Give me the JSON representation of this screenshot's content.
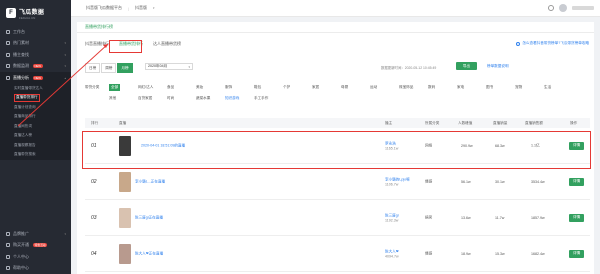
{
  "app": {
    "logo_text": "飞瓜数据",
    "logo_sub": "FEIGUA.CN",
    "logo_mark": "F"
  },
  "sidebar": {
    "items": [
      {
        "label": "工作台",
        "icon": "home-icon"
      },
      {
        "label": "热门素材",
        "icon": "fire-icon"
      },
      {
        "label": "播主查找",
        "icon": "user-search-icon"
      },
      {
        "label": "数据监测",
        "icon": "monitor-icon",
        "badge": "NEW"
      },
      {
        "label": "直播分析",
        "icon": "live-icon",
        "badge": "NEW"
      }
    ],
    "subitems": [
      {
        "label": "实时直播带货达人"
      },
      {
        "label": "直播带货排行",
        "current": true
      },
      {
        "label": "直播计划查询"
      },
      {
        "label": "直播商品排行"
      },
      {
        "label": "直播间热词"
      },
      {
        "label": "直播达人榜"
      },
      {
        "label": "直播观察报告"
      },
      {
        "label": "直播带货搜索"
      }
    ],
    "bottom_items": [
      {
        "label": "品牌推广",
        "icon": "brand-icon"
      },
      {
        "label": "购买开通",
        "icon": "cart-icon",
        "badge": "特惠活动"
      },
      {
        "label": "个人中心",
        "icon": "person-icon"
      },
      {
        "label": "帮助中心",
        "icon": "help-icon"
      }
    ]
  },
  "topbar": {
    "crumbs": [
      "抖音版飞瓜数据平台",
      "抖音版"
    ]
  },
  "page": {
    "heading": "直播带货排行榜",
    "tabs": [
      {
        "label": "抖音直播排行",
        "selected": false
      },
      {
        "label": "直播带货排行",
        "selected": true
      },
      {
        "label": "达人直播带货榜",
        "selected": false
      }
    ],
    "top_link": "怎么查看抖音带货榜单?飞瓜带货榜单攻略",
    "period_buttons": [
      {
        "label": "日榜",
        "on": false
      },
      {
        "label": "周榜",
        "on": false
      },
      {
        "label": "月榜",
        "on": true
      }
    ],
    "month_value": "2020年04月",
    "update_time": "数据更新时间：2020-05-12 10:45:49",
    "export_label": "导出",
    "explain_link": "榜单数据说明",
    "category_label": "带货分类",
    "categories": [
      {
        "label": "全部",
        "on": true
      },
      {
        "label": "网红/达人"
      },
      {
        "label": "食品"
      },
      {
        "label": "美妆"
      },
      {
        "label": "服饰"
      },
      {
        "label": "鞋包"
      },
      {
        "label": "个护"
      },
      {
        "label": "家居"
      },
      {
        "label": "母婴"
      },
      {
        "label": "运动"
      },
      {
        "label": "珠宝饰品"
      },
      {
        "label": "数码"
      },
      {
        "label": "家电"
      },
      {
        "label": "图书"
      },
      {
        "label": "宠物"
      },
      {
        "label": "生活"
      },
      {
        "label": "其他"
      },
      {
        "label": "百货家居"
      },
      {
        "label": "时尚"
      },
      {
        "label": "蔬菜水果"
      },
      {
        "label": "知识游戏",
        "blue": true
      },
      {
        "label": "手工手作"
      }
    ]
  },
  "table": {
    "headers": [
      "排行",
      "直播",
      "播主",
      "所属分类",
      "人数峰值",
      "直播销量",
      "直播销售额",
      "操作"
    ],
    "rows": [
      {
        "rank": "01",
        "title": "2020-04-01 18:51:09的直播",
        "anchor": "罗永浩",
        "fans": "1165.1w",
        "category": "网络",
        "peak": "290.9w",
        "sales": "68.3w",
        "revenue": "1.1亿",
        "action": "详情",
        "thumb_color": "#3a3a3a"
      },
      {
        "rank": "02",
        "title": "李小璐L...正在直播",
        "anchor": "李小璐的Lpjo嘛",
        "fans": "1106.7w",
        "category": "情感",
        "peak": "56.1w",
        "sales": "30.1w",
        "revenue": "3534.4w",
        "action": "详情",
        "thumb_color": "#c8a88a"
      },
      {
        "rank": "03",
        "title": "陈三废gi正在直播",
        "anchor": "陈三废gi",
        "fans": "1192.3w",
        "category": "搞笑",
        "peak": "13.6w",
        "sales": "11.7w",
        "revenue": "1857.9w",
        "action": "详情",
        "thumb_color": "#d9c2b0"
      },
      {
        "rank": "04",
        "title": "陈大人❤正在直播",
        "anchor": "陈大人❤",
        "fans": "4094.7w",
        "category": "情感",
        "peak": "18.9w",
        "sales": "15.3w",
        "revenue": "1682.4w",
        "action": "详情",
        "thumb_color": "#b89a8e"
      }
    ]
  },
  "colors": {
    "accent": "#32a05f",
    "link": "#2f80ed",
    "highlight": "#e53935",
    "sidebar_bg": "#262a33"
  }
}
